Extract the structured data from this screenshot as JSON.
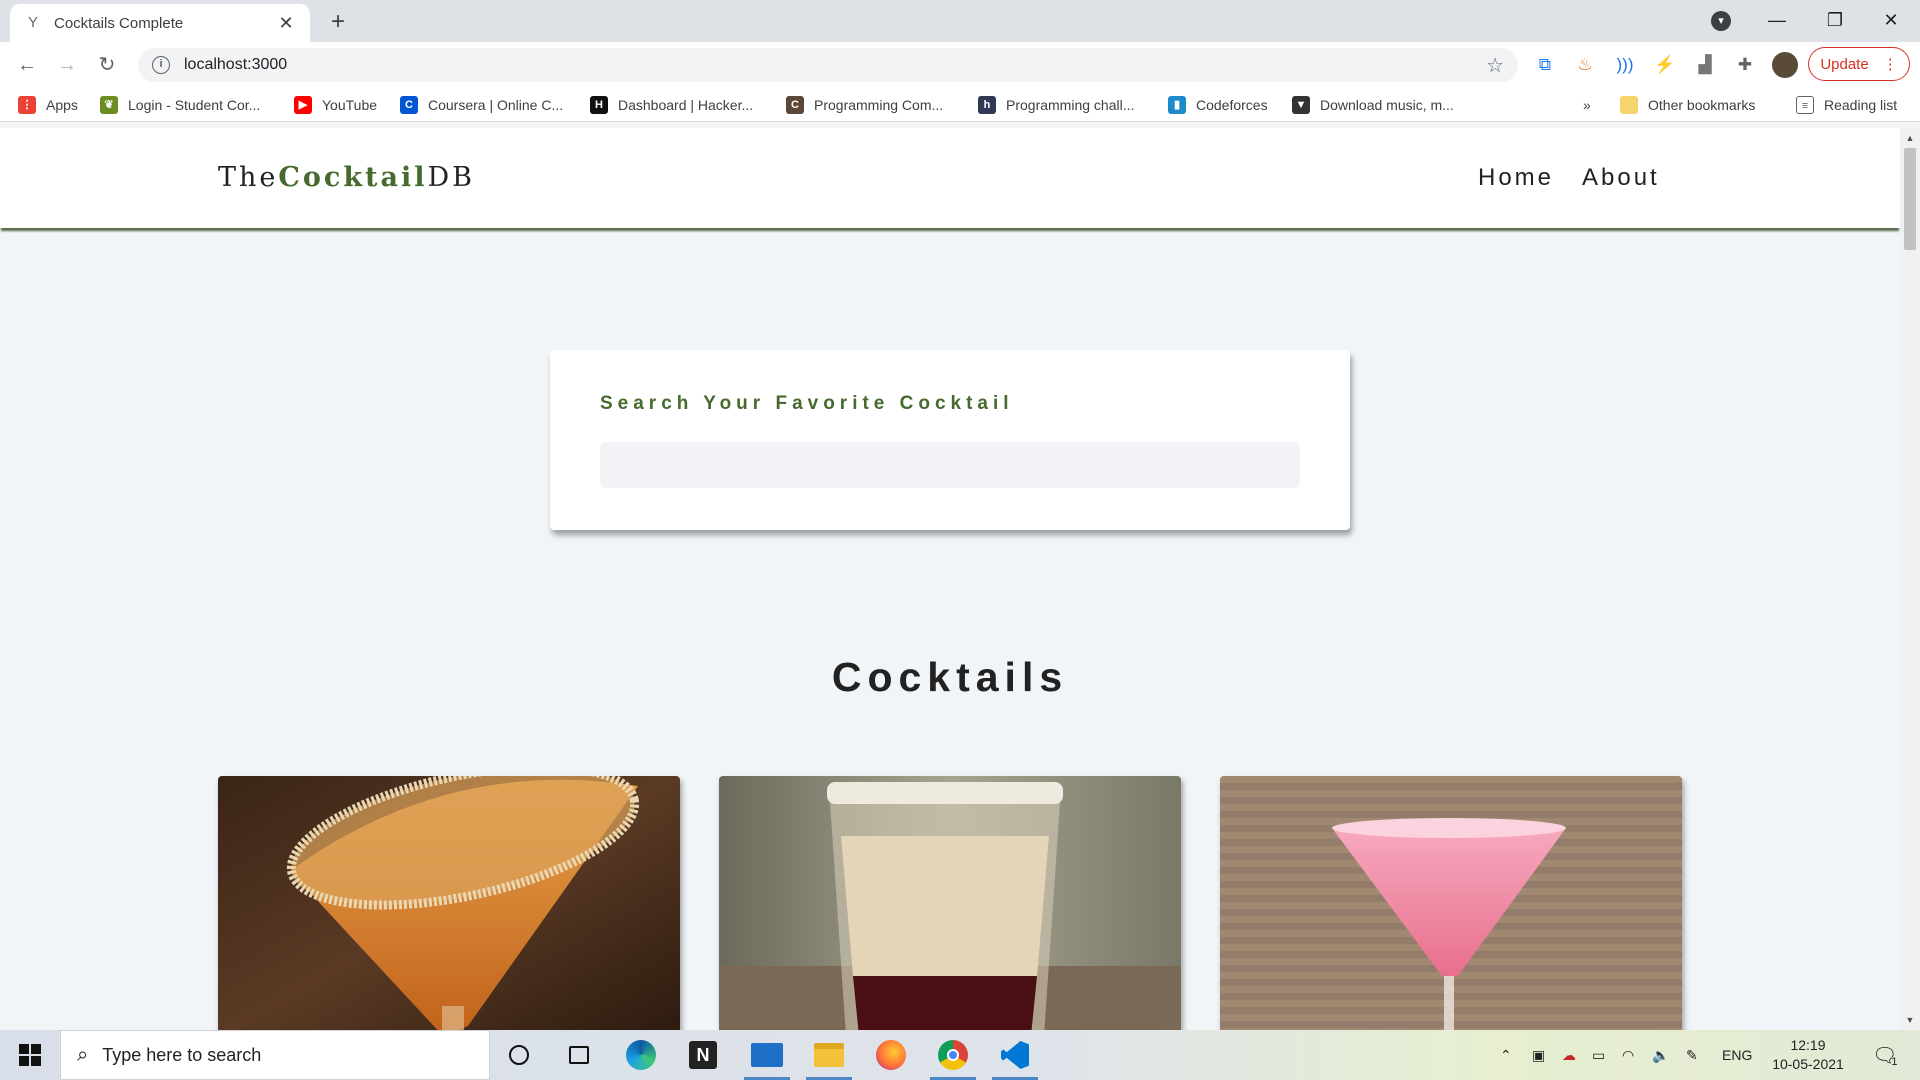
{
  "browser": {
    "tab_title": "Cocktails Complete",
    "url": "localhost:3000",
    "update_label": "Update",
    "bookmarks": [
      {
        "label": "Apps",
        "icon": "apps-grid-icon",
        "color": "#ea4335"
      },
      {
        "label": "Login - Student Cor...",
        "icon": "frog-icon",
        "color": "#6b8e23"
      },
      {
        "label": "YouTube",
        "icon": "youtube-icon",
        "color": "#ff0000"
      },
      {
        "label": "Coursera | Online C...",
        "icon": "coursera-icon",
        "color": "#0056d2"
      },
      {
        "label": "Dashboard | Hacker...",
        "icon": "hackerrank-icon",
        "color": "#111111"
      },
      {
        "label": "Programming Com...",
        "icon": "codechef-icon",
        "color": "#5b4638"
      },
      {
        "label": "Programming chall...",
        "icon": "hackerearth-icon",
        "color": "#323754"
      },
      {
        "label": "Codeforces",
        "icon": "codeforces-icon",
        "color": "#1f8acb"
      },
      {
        "label": "Download music, m...",
        "icon": "download-icon",
        "color": "#333333"
      }
    ],
    "other_bookmarks": "Other bookmarks",
    "reading_list": "Reading list",
    "more": "»"
  },
  "site": {
    "logo_prefix": "The",
    "logo_accent": "Cocktail",
    "logo_suffix": "DB",
    "nav": [
      "Home",
      "About"
    ],
    "accent_color": "#476a2e",
    "search_label": "Search Your Favorite Cocktail",
    "search_value": "",
    "section_title": "Cocktails",
    "cards": [
      {
        "image": "orange-margarita-glass-image"
      },
      {
        "image": "layered-shot-glass-image"
      },
      {
        "image": "pink-martini-glass-image"
      }
    ]
  },
  "taskbar": {
    "search_placeholder": "Type here to search",
    "language": "ENG",
    "time": "12:19",
    "date": "10-05-2021",
    "notifications": "1"
  }
}
